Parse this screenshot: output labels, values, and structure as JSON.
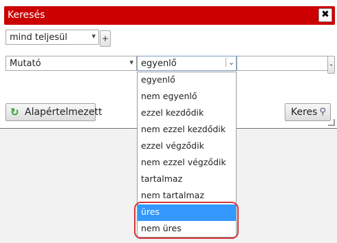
{
  "dialog": {
    "title": "Keresés",
    "close_label": "✖"
  },
  "match_select": {
    "value": "mind teljesül"
  },
  "add_label": "+",
  "field_select": {
    "value": "Mutató"
  },
  "operator_select": {
    "value": "egyenlő"
  },
  "value_input": {
    "value": ""
  },
  "remove_label": "-",
  "reset_button": {
    "label": "Alapértelmezett"
  },
  "search_button": {
    "label": "Keres"
  },
  "dropdown": {
    "options": [
      "egyenlő",
      "nem egyenlő",
      "ezzel kezdődik",
      "nem ezzel kezdődik",
      "ezzel végződik",
      "nem ezzel végződik",
      "tartalmaz",
      "nem tartalmaz",
      "üres",
      "nem üres"
    ],
    "selected": "üres"
  },
  "colors": {
    "titlebar": "#cc0000",
    "selection": "#3399ff",
    "annotation": "#d4363b"
  }
}
